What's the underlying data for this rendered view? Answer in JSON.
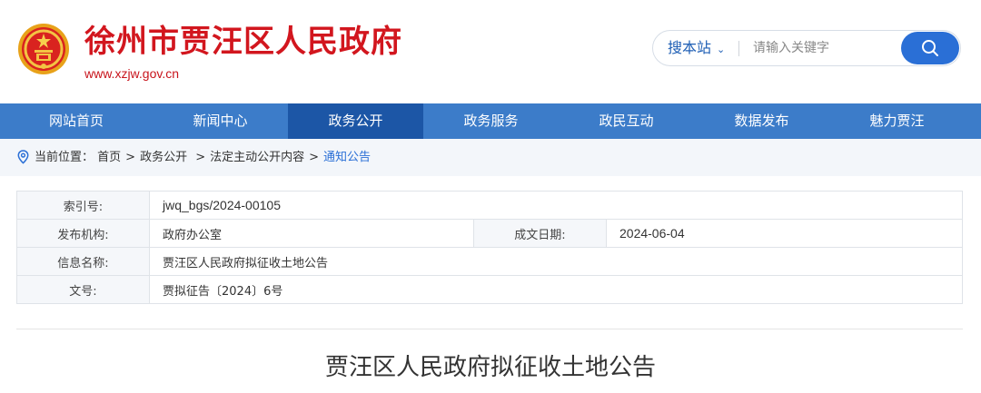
{
  "header": {
    "site_title": "徐州市贾汪区人民政府",
    "site_url": "www.xzjw.gov.cn"
  },
  "search": {
    "scope_label": "搜本站",
    "placeholder": "请输入关键字"
  },
  "nav": {
    "items": [
      {
        "label": "网站首页"
      },
      {
        "label": "新闻中心"
      },
      {
        "label": "政务公开"
      },
      {
        "label": "政务服务"
      },
      {
        "label": "政民互动"
      },
      {
        "label": "数据发布"
      },
      {
        "label": "魅力贾汪"
      }
    ],
    "active_index": 2
  },
  "breadcrumb": {
    "prefix": "当前位置：",
    "items": [
      "首页",
      "政务公开",
      "法定主动公开内容",
      "通知公告"
    ]
  },
  "info": {
    "index_label": "索引号:",
    "index_value": "jwq_bgs/2024-00105",
    "publisher_label": "发布机构:",
    "publisher_value": "政府办公室",
    "date_label": "成文日期:",
    "date_value": "2024-06-04",
    "name_label": "信息名称:",
    "name_value": "贾汪区人民政府拟征收土地公告",
    "doc_label": "文号:",
    "doc_value": "贾拟征告〔2024〕6号"
  },
  "article": {
    "title": "贾汪区人民政府拟征收土地公告"
  },
  "colors": {
    "brand_red": "#d2161e",
    "nav_blue": "#3c7cc9",
    "nav_active": "#1c56a6",
    "search_button": "#2a6fd6"
  }
}
